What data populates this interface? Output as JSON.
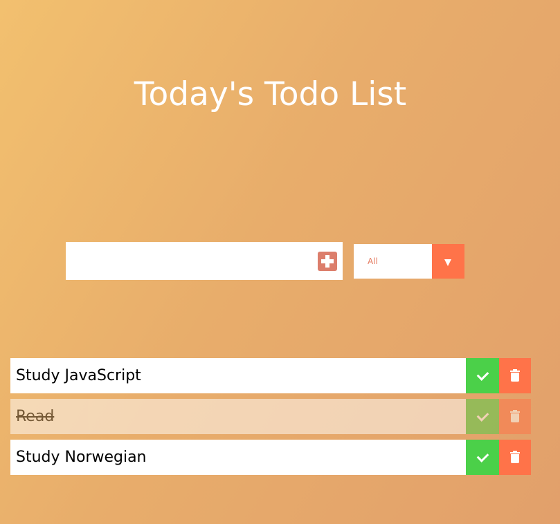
{
  "header": {
    "title": "Today's Todo List"
  },
  "form": {
    "input_value": "",
    "input_placeholder": "",
    "add_icon": "plus-square-icon"
  },
  "filter": {
    "selected": "All",
    "arrow_icon": "triangle-down-icon"
  },
  "todos": [
    {
      "text": "Study JavaScript",
      "completed": false
    },
    {
      "text": "Read",
      "completed": true
    },
    {
      "text": "Study Norwegian",
      "completed": false
    }
  ],
  "colors": {
    "complete_button": "#4bd049",
    "trash_button": "#ff7349",
    "add_button": "#dc7e6c",
    "accent": "#ff7349"
  }
}
